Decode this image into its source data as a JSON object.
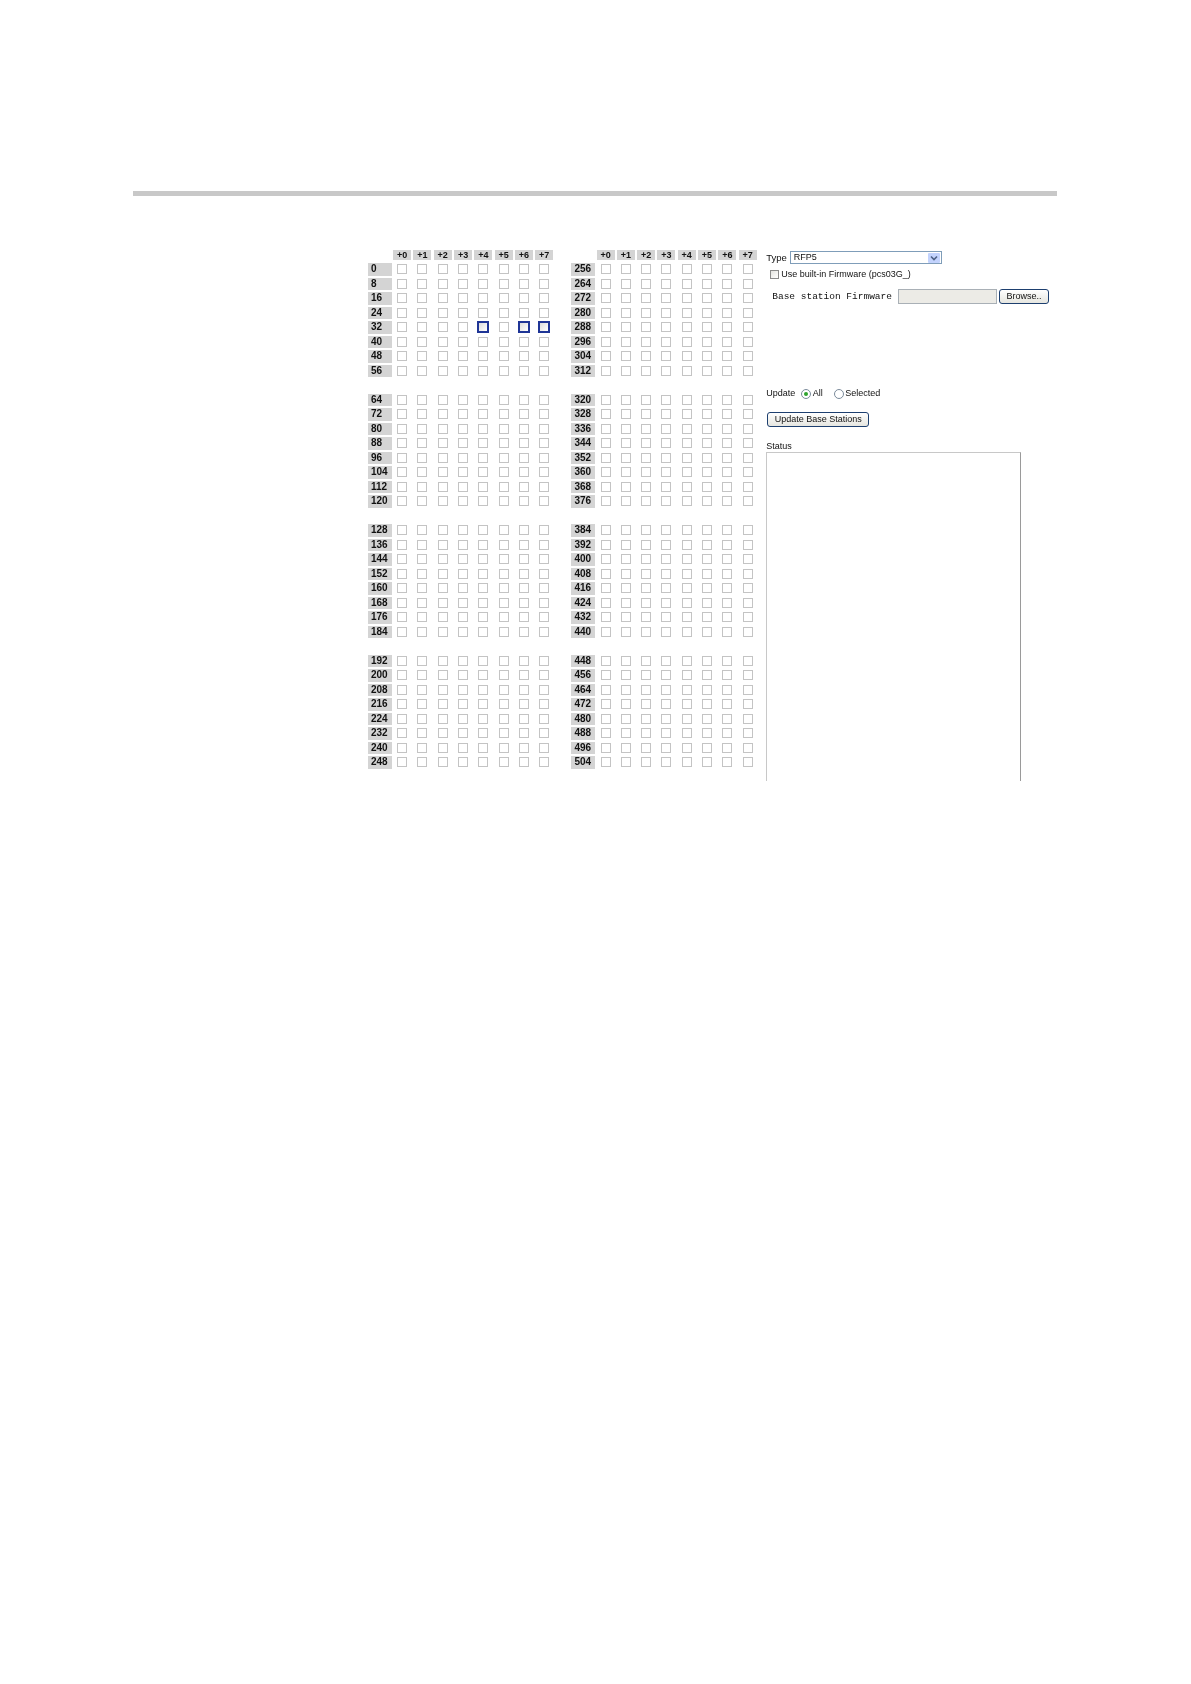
{
  "grid": {
    "blocks": [
      {
        "column_headers": [
          "+0",
          "+1",
          "+2",
          "+3",
          "+4",
          "+5",
          "+6",
          "+7"
        ],
        "groups": [
          {
            "rows": [
              {
                "label": "0",
                "highlighted": [
                  false,
                  false,
                  false,
                  false,
                  false,
                  false,
                  false,
                  false
                ]
              },
              {
                "label": "8",
                "highlighted": [
                  false,
                  false,
                  false,
                  false,
                  false,
                  false,
                  false,
                  false
                ]
              },
              {
                "label": "16",
                "highlighted": [
                  false,
                  false,
                  false,
                  false,
                  false,
                  false,
                  false,
                  false
                ]
              },
              {
                "label": "24",
                "highlighted": [
                  false,
                  false,
                  false,
                  false,
                  false,
                  false,
                  false,
                  false
                ]
              },
              {
                "label": "32",
                "highlighted": [
                  false,
                  false,
                  false,
                  false,
                  true,
                  false,
                  true,
                  true
                ]
              },
              {
                "label": "40",
                "highlighted": [
                  false,
                  false,
                  false,
                  false,
                  false,
                  false,
                  false,
                  false
                ]
              },
              {
                "label": "48",
                "highlighted": [
                  false,
                  false,
                  false,
                  false,
                  false,
                  false,
                  false,
                  false
                ]
              },
              {
                "label": "56",
                "highlighted": [
                  false,
                  false,
                  false,
                  false,
                  false,
                  false,
                  false,
                  false
                ]
              }
            ]
          },
          {
            "rows": [
              {
                "label": "64",
                "highlighted": [
                  false,
                  false,
                  false,
                  false,
                  false,
                  false,
                  false,
                  false
                ]
              },
              {
                "label": "72",
                "highlighted": [
                  false,
                  false,
                  false,
                  false,
                  false,
                  false,
                  false,
                  false
                ]
              },
              {
                "label": "80",
                "highlighted": [
                  false,
                  false,
                  false,
                  false,
                  false,
                  false,
                  false,
                  false
                ]
              },
              {
                "label": "88",
                "highlighted": [
                  false,
                  false,
                  false,
                  false,
                  false,
                  false,
                  false,
                  false
                ]
              },
              {
                "label": "96",
                "highlighted": [
                  false,
                  false,
                  false,
                  false,
                  false,
                  false,
                  false,
                  false
                ]
              },
              {
                "label": "104",
                "highlighted": [
                  false,
                  false,
                  false,
                  false,
                  false,
                  false,
                  false,
                  false
                ]
              },
              {
                "label": "112",
                "highlighted": [
                  false,
                  false,
                  false,
                  false,
                  false,
                  false,
                  false,
                  false
                ]
              },
              {
                "label": "120",
                "highlighted": [
                  false,
                  false,
                  false,
                  false,
                  false,
                  false,
                  false,
                  false
                ]
              }
            ]
          },
          {
            "rows": [
              {
                "label": "128",
                "highlighted": [
                  false,
                  false,
                  false,
                  false,
                  false,
                  false,
                  false,
                  false
                ]
              },
              {
                "label": "136",
                "highlighted": [
                  false,
                  false,
                  false,
                  false,
                  false,
                  false,
                  false,
                  false
                ]
              },
              {
                "label": "144",
                "highlighted": [
                  false,
                  false,
                  false,
                  false,
                  false,
                  false,
                  false,
                  false
                ]
              },
              {
                "label": "152",
                "highlighted": [
                  false,
                  false,
                  false,
                  false,
                  false,
                  false,
                  false,
                  false
                ]
              },
              {
                "label": "160",
                "highlighted": [
                  false,
                  false,
                  false,
                  false,
                  false,
                  false,
                  false,
                  false
                ]
              },
              {
                "label": "168",
                "highlighted": [
                  false,
                  false,
                  false,
                  false,
                  false,
                  false,
                  false,
                  false
                ]
              },
              {
                "label": "176",
                "highlighted": [
                  false,
                  false,
                  false,
                  false,
                  false,
                  false,
                  false,
                  false
                ]
              },
              {
                "label": "184",
                "highlighted": [
                  false,
                  false,
                  false,
                  false,
                  false,
                  false,
                  false,
                  false
                ]
              }
            ]
          },
          {
            "rows": [
              {
                "label": "192",
                "highlighted": [
                  false,
                  false,
                  false,
                  false,
                  false,
                  false,
                  false,
                  false
                ]
              },
              {
                "label": "200",
                "highlighted": [
                  false,
                  false,
                  false,
                  false,
                  false,
                  false,
                  false,
                  false
                ]
              },
              {
                "label": "208",
                "highlighted": [
                  false,
                  false,
                  false,
                  false,
                  false,
                  false,
                  false,
                  false
                ]
              },
              {
                "label": "216",
                "highlighted": [
                  false,
                  false,
                  false,
                  false,
                  false,
                  false,
                  false,
                  false
                ]
              },
              {
                "label": "224",
                "highlighted": [
                  false,
                  false,
                  false,
                  false,
                  false,
                  false,
                  false,
                  false
                ]
              },
              {
                "label": "232",
                "highlighted": [
                  false,
                  false,
                  false,
                  false,
                  false,
                  false,
                  false,
                  false
                ]
              },
              {
                "label": "240",
                "highlighted": [
                  false,
                  false,
                  false,
                  false,
                  false,
                  false,
                  false,
                  false
                ]
              },
              {
                "label": "248",
                "highlighted": [
                  false,
                  false,
                  false,
                  false,
                  false,
                  false,
                  false,
                  false
                ]
              }
            ]
          }
        ]
      },
      {
        "column_headers": [
          "+0",
          "+1",
          "+2",
          "+3",
          "+4",
          "+5",
          "+6",
          "+7"
        ],
        "groups": [
          {
            "rows": [
              {
                "label": "256",
                "highlighted": [
                  false,
                  false,
                  false,
                  false,
                  false,
                  false,
                  false,
                  false
                ]
              },
              {
                "label": "264",
                "highlighted": [
                  false,
                  false,
                  false,
                  false,
                  false,
                  false,
                  false,
                  false
                ]
              },
              {
                "label": "272",
                "highlighted": [
                  false,
                  false,
                  false,
                  false,
                  false,
                  false,
                  false,
                  false
                ]
              },
              {
                "label": "280",
                "highlighted": [
                  false,
                  false,
                  false,
                  false,
                  false,
                  false,
                  false,
                  false
                ]
              },
              {
                "label": "288",
                "highlighted": [
                  false,
                  false,
                  false,
                  false,
                  false,
                  false,
                  false,
                  false
                ]
              },
              {
                "label": "296",
                "highlighted": [
                  false,
                  false,
                  false,
                  false,
                  false,
                  false,
                  false,
                  false
                ]
              },
              {
                "label": "304",
                "highlighted": [
                  false,
                  false,
                  false,
                  false,
                  false,
                  false,
                  false,
                  false
                ]
              },
              {
                "label": "312",
                "highlighted": [
                  false,
                  false,
                  false,
                  false,
                  false,
                  false,
                  false,
                  false
                ]
              }
            ]
          },
          {
            "rows": [
              {
                "label": "320",
                "highlighted": [
                  false,
                  false,
                  false,
                  false,
                  false,
                  false,
                  false,
                  false
                ]
              },
              {
                "label": "328",
                "highlighted": [
                  false,
                  false,
                  false,
                  false,
                  false,
                  false,
                  false,
                  false
                ]
              },
              {
                "label": "336",
                "highlighted": [
                  false,
                  false,
                  false,
                  false,
                  false,
                  false,
                  false,
                  false
                ]
              },
              {
                "label": "344",
                "highlighted": [
                  false,
                  false,
                  false,
                  false,
                  false,
                  false,
                  false,
                  false
                ]
              },
              {
                "label": "352",
                "highlighted": [
                  false,
                  false,
                  false,
                  false,
                  false,
                  false,
                  false,
                  false
                ]
              },
              {
                "label": "360",
                "highlighted": [
                  false,
                  false,
                  false,
                  false,
                  false,
                  false,
                  false,
                  false
                ]
              },
              {
                "label": "368",
                "highlighted": [
                  false,
                  false,
                  false,
                  false,
                  false,
                  false,
                  false,
                  false
                ]
              },
              {
                "label": "376",
                "highlighted": [
                  false,
                  false,
                  false,
                  false,
                  false,
                  false,
                  false,
                  false
                ]
              }
            ]
          },
          {
            "rows": [
              {
                "label": "384",
                "highlighted": [
                  false,
                  false,
                  false,
                  false,
                  false,
                  false,
                  false,
                  false
                ]
              },
              {
                "label": "392",
                "highlighted": [
                  false,
                  false,
                  false,
                  false,
                  false,
                  false,
                  false,
                  false
                ]
              },
              {
                "label": "400",
                "highlighted": [
                  false,
                  false,
                  false,
                  false,
                  false,
                  false,
                  false,
                  false
                ]
              },
              {
                "label": "408",
                "highlighted": [
                  false,
                  false,
                  false,
                  false,
                  false,
                  false,
                  false,
                  false
                ]
              },
              {
                "label": "416",
                "highlighted": [
                  false,
                  false,
                  false,
                  false,
                  false,
                  false,
                  false,
                  false
                ]
              },
              {
                "label": "424",
                "highlighted": [
                  false,
                  false,
                  false,
                  false,
                  false,
                  false,
                  false,
                  false
                ]
              },
              {
                "label": "432",
                "highlighted": [
                  false,
                  false,
                  false,
                  false,
                  false,
                  false,
                  false,
                  false
                ]
              },
              {
                "label": "440",
                "highlighted": [
                  false,
                  false,
                  false,
                  false,
                  false,
                  false,
                  false,
                  false
                ]
              }
            ]
          },
          {
            "rows": [
              {
                "label": "448",
                "highlighted": [
                  false,
                  false,
                  false,
                  false,
                  false,
                  false,
                  false,
                  false
                ]
              },
              {
                "label": "456",
                "highlighted": [
                  false,
                  false,
                  false,
                  false,
                  false,
                  false,
                  false,
                  false
                ]
              },
              {
                "label": "464",
                "highlighted": [
                  false,
                  false,
                  false,
                  false,
                  false,
                  false,
                  false,
                  false
                ]
              },
              {
                "label": "472",
                "highlighted": [
                  false,
                  false,
                  false,
                  false,
                  false,
                  false,
                  false,
                  false
                ]
              },
              {
                "label": "480",
                "highlighted": [
                  false,
                  false,
                  false,
                  false,
                  false,
                  false,
                  false,
                  false
                ]
              },
              {
                "label": "488",
                "highlighted": [
                  false,
                  false,
                  false,
                  false,
                  false,
                  false,
                  false,
                  false
                ]
              },
              {
                "label": "496",
                "highlighted": [
                  false,
                  false,
                  false,
                  false,
                  false,
                  false,
                  false,
                  false
                ]
              },
              {
                "label": "504",
                "highlighted": [
                  false,
                  false,
                  false,
                  false,
                  false,
                  false,
                  false,
                  false
                ]
              }
            ]
          }
        ]
      }
    ]
  },
  "firmware_panel": {
    "type_field": {
      "label": "Type",
      "value": "RFP5"
    },
    "builtin_firmware": {
      "label": "Use built-in Firmware (pcs03G_)",
      "checked": false
    },
    "file_field": {
      "label": "Base station Firmware",
      "button": "Browse.."
    },
    "update": {
      "label": "Update",
      "options": [
        {
          "label": "All",
          "selected": true
        },
        {
          "label": "Selected",
          "selected": false
        }
      ]
    },
    "update_button": "Update Base Stations",
    "status": {
      "label": "Status"
    }
  }
}
